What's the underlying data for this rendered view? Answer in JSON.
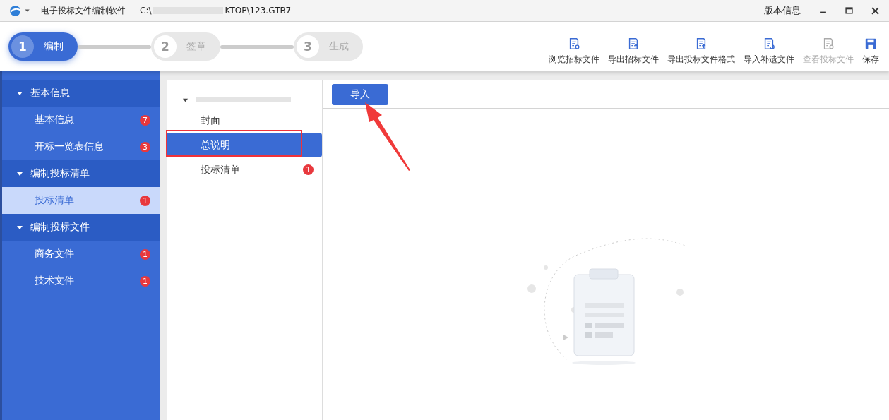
{
  "window": {
    "title": "电子投标文件编制软件",
    "path_start": "C:\\",
    "path_end": "KTOP\\123.GTB7",
    "version_link": "版本信息"
  },
  "steps": [
    {
      "number": "1",
      "label": "编制",
      "selected": true
    },
    {
      "number": "2",
      "label": "签章",
      "selected": false
    },
    {
      "number": "3",
      "label": "生成",
      "selected": false
    }
  ],
  "toolbar": [
    {
      "label": "浏览招标文件",
      "kind": "view",
      "disabled": false
    },
    {
      "label": "导出招标文件",
      "kind": "export",
      "disabled": false
    },
    {
      "label": "导出投标文件格式",
      "kind": "export",
      "disabled": false
    },
    {
      "label": "导入补遗文件",
      "kind": "import",
      "disabled": false
    },
    {
      "label": "查看投标文件",
      "kind": "view",
      "disabled": true
    },
    {
      "label": "保存",
      "kind": "save",
      "disabled": false
    }
  ],
  "sidebar": [
    {
      "label": "基本信息",
      "expanded": true,
      "children": [
        {
          "label": "基本信息",
          "badge": "7",
          "selected": false
        },
        {
          "label": "开标一览表信息",
          "badge": "3",
          "selected": false
        }
      ]
    },
    {
      "label": "编制投标清单",
      "expanded": true,
      "children": [
        {
          "label": "投标清单",
          "badge": "1",
          "selected": true
        }
      ]
    },
    {
      "label": "编制投标文件",
      "expanded": true,
      "children": [
        {
          "label": "商务文件",
          "badge": "1",
          "selected": false
        },
        {
          "label": "技术文件",
          "badge": "1",
          "selected": false
        }
      ]
    }
  ],
  "tree": {
    "expanded": true,
    "children": [
      {
        "label": "封面",
        "selected": false
      },
      {
        "label": "总说明",
        "selected": true
      },
      {
        "label": "投标清单",
        "badge": "1",
        "selected": false
      }
    ]
  },
  "content": {
    "import_button": "导入"
  }
}
